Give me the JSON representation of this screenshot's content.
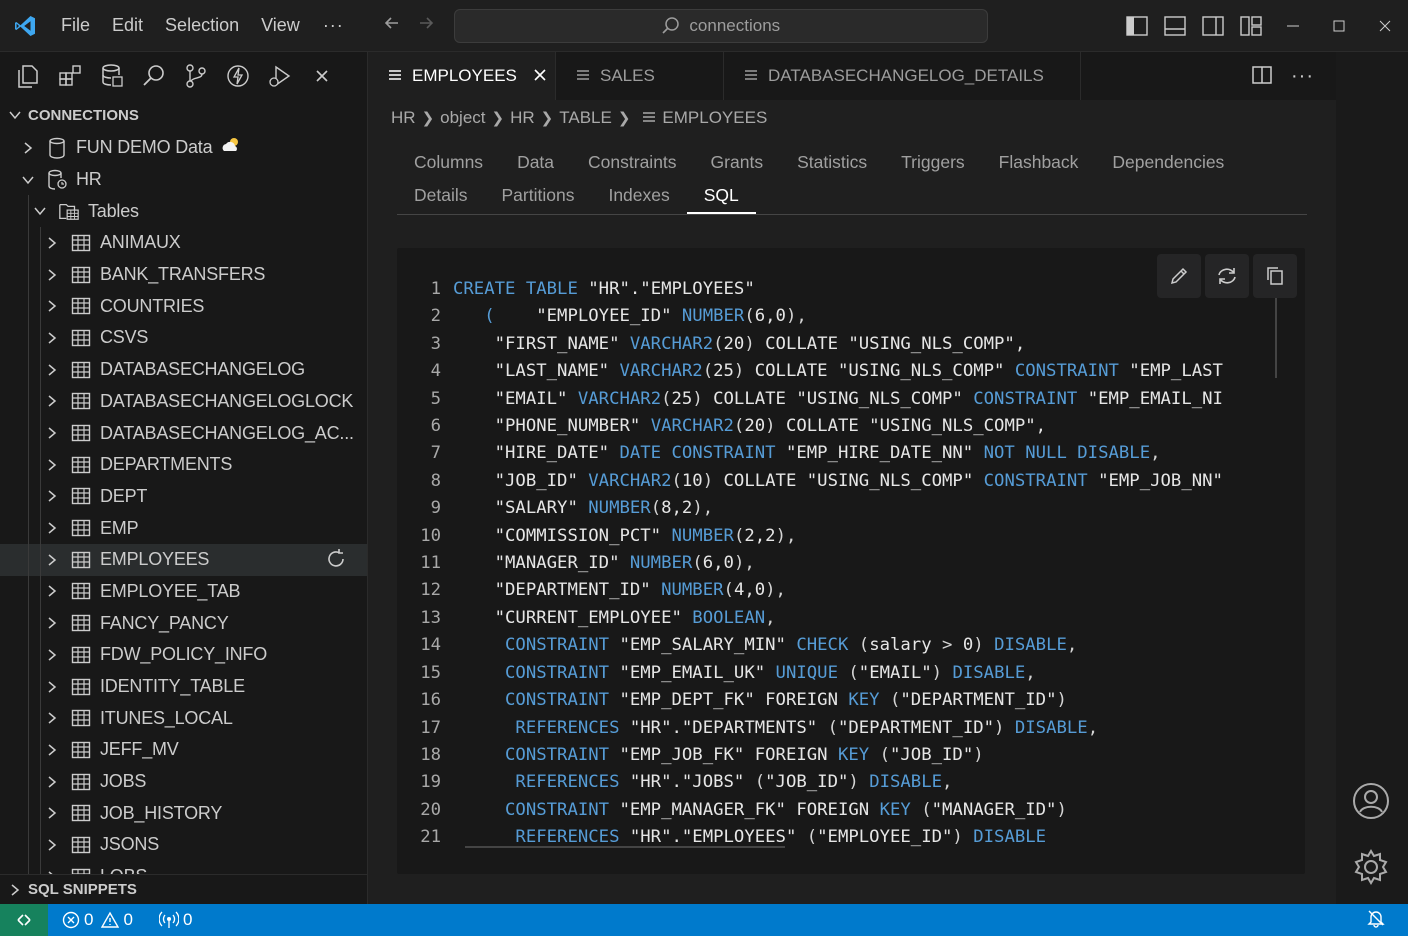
{
  "titlebar": {
    "menu": [
      "File",
      "Edit",
      "Selection",
      "View"
    ],
    "more": "···",
    "search_text": "connections"
  },
  "sidebar": {
    "connections_header": "CONNECTIONS",
    "tree": [
      {
        "label": "FUN DEMO Data",
        "level": 0,
        "icon": "database-icon"
      },
      {
        "label": "HR",
        "level": 0,
        "icon": "database-connected-icon"
      },
      {
        "label": "Tables",
        "level": 1,
        "icon": "folder-tables-icon"
      },
      {
        "label": "ANIMAUX",
        "level": 2,
        "icon": "table-icon"
      },
      {
        "label": "BANK_TRANSFERS",
        "level": 2,
        "icon": "table-icon"
      },
      {
        "label": "COUNTRIES",
        "level": 2,
        "icon": "table-icon"
      },
      {
        "label": "CSVS",
        "level": 2,
        "icon": "table-icon"
      },
      {
        "label": "DATABASECHANGELOG",
        "level": 2,
        "icon": "table-icon"
      },
      {
        "label": "DATABASECHANGELOGLOCK",
        "level": 2,
        "icon": "table-icon"
      },
      {
        "label": "DATABASECHANGELOG_AC...",
        "level": 2,
        "icon": "table-icon"
      },
      {
        "label": "DEPARTMENTS",
        "level": 2,
        "icon": "table-icon"
      },
      {
        "label": "DEPT",
        "level": 2,
        "icon": "table-icon"
      },
      {
        "label": "EMP",
        "level": 2,
        "icon": "table-icon"
      },
      {
        "label": "EMPLOYEES",
        "level": 2,
        "icon": "table-icon",
        "selected": true
      },
      {
        "label": "EMPLOYEE_TAB",
        "level": 2,
        "icon": "table-icon"
      },
      {
        "label": "FANCY_PANCY",
        "level": 2,
        "icon": "table-icon"
      },
      {
        "label": "FDW_POLICY_INFO",
        "level": 2,
        "icon": "table-icon"
      },
      {
        "label": "IDENTITY_TABLE",
        "level": 2,
        "icon": "table-icon"
      },
      {
        "label": "ITUNES_LOCAL",
        "level": 2,
        "icon": "table-icon"
      },
      {
        "label": "JEFF_MV",
        "level": 2,
        "icon": "table-icon"
      },
      {
        "label": "JOBS",
        "level": 2,
        "icon": "table-icon"
      },
      {
        "label": "JOB_HISTORY",
        "level": 2,
        "icon": "table-icon"
      },
      {
        "label": "JSONS",
        "level": 2,
        "icon": "table-icon"
      },
      {
        "label": "LOBS",
        "level": 2,
        "icon": "table-icon"
      }
    ],
    "snippets_header": "SQL SNIPPETS"
  },
  "editor": {
    "tabs": [
      {
        "label": "EMPLOYEES",
        "active": true
      },
      {
        "label": "SALES",
        "active": false
      },
      {
        "label": "DATABASECHANGELOG_DETAILS",
        "active": false
      }
    ],
    "breadcrumb": [
      "HR",
      "object",
      "HR",
      "TABLE",
      "EMPLOYEES"
    ],
    "detail_tabs_row1": [
      "Columns",
      "Data",
      "Constraints",
      "Grants",
      "Statistics",
      "Triggers",
      "Flashback",
      "Dependencies"
    ],
    "detail_tabs_row2": [
      "Details",
      "Partitions",
      "Indexes",
      "SQL"
    ],
    "active_detail_tab": "SQL",
    "code_lines": [
      [
        [
          "k",
          "CREATE TABLE "
        ],
        [
          "s",
          "\"HR\".\"EMPLOYEES\""
        ]
      ],
      [
        [
          "k",
          "   (    "
        ],
        [
          "s",
          "\"EMPLOYEE_ID\" "
        ],
        [
          "k",
          "NUMBER"
        ],
        [
          "p",
          "("
        ],
        [
          "s",
          "6,0"
        ],
        [
          "p",
          "),"
        ]
      ],
      [
        [
          "s",
          "    \"FIRST_NAME\" "
        ],
        [
          "k",
          "VARCHAR2"
        ],
        [
          "p",
          "("
        ],
        [
          "s",
          "20"
        ],
        [
          "p",
          ") "
        ],
        [
          "s",
          "COLLATE \"USING_NLS_COMP\","
        ]
      ],
      [
        [
          "s",
          "    \"LAST_NAME\" "
        ],
        [
          "k",
          "VARCHAR2"
        ],
        [
          "p",
          "("
        ],
        [
          "s",
          "25"
        ],
        [
          "p",
          ") "
        ],
        [
          "s",
          "COLLATE \"USING_NLS_COMP\" "
        ],
        [
          "k",
          "CONSTRAINT "
        ],
        [
          "s",
          "\"EMP_LAST"
        ]
      ],
      [
        [
          "s",
          "    \"EMAIL\" "
        ],
        [
          "k",
          "VARCHAR2"
        ],
        [
          "p",
          "("
        ],
        [
          "s",
          "25"
        ],
        [
          "p",
          ") "
        ],
        [
          "s",
          "COLLATE \"USING_NLS_COMP\" "
        ],
        [
          "k",
          "CONSTRAINT "
        ],
        [
          "s",
          "\"EMP_EMAIL_NI"
        ]
      ],
      [
        [
          "s",
          "    \"PHONE_NUMBER\" "
        ],
        [
          "k",
          "VARCHAR2"
        ],
        [
          "p",
          "("
        ],
        [
          "s",
          "20"
        ],
        [
          "p",
          ") "
        ],
        [
          "s",
          "COLLATE \"USING_NLS_COMP\","
        ]
      ],
      [
        [
          "s",
          "    \"HIRE_DATE\" "
        ],
        [
          "k",
          "DATE CONSTRAINT "
        ],
        [
          "s",
          "\"EMP_HIRE_DATE_NN\" "
        ],
        [
          "k",
          "NOT NULL DISABLE"
        ],
        [
          "p",
          ","
        ]
      ],
      [
        [
          "s",
          "    \"JOB_ID\" "
        ],
        [
          "k",
          "VARCHAR2"
        ],
        [
          "p",
          "("
        ],
        [
          "s",
          "10"
        ],
        [
          "p",
          ") "
        ],
        [
          "s",
          "COLLATE \"USING_NLS_COMP\" "
        ],
        [
          "k",
          "CONSTRAINT "
        ],
        [
          "s",
          "\"EMP_JOB_NN\""
        ]
      ],
      [
        [
          "s",
          "    \"SALARY\" "
        ],
        [
          "k",
          "NUMBER"
        ],
        [
          "p",
          "("
        ],
        [
          "s",
          "8,2"
        ],
        [
          "p",
          "),"
        ]
      ],
      [
        [
          "s",
          "    \"COMMISSION_PCT\" "
        ],
        [
          "k",
          "NUMBER"
        ],
        [
          "p",
          "("
        ],
        [
          "s",
          "2,2"
        ],
        [
          "p",
          "),"
        ]
      ],
      [
        [
          "s",
          "    \"MANAGER_ID\" "
        ],
        [
          "k",
          "NUMBER"
        ],
        [
          "p",
          "("
        ],
        [
          "s",
          "6,0"
        ],
        [
          "p",
          "),"
        ]
      ],
      [
        [
          "s",
          "    \"DEPARTMENT_ID\" "
        ],
        [
          "k",
          "NUMBER"
        ],
        [
          "p",
          "("
        ],
        [
          "s",
          "4,0"
        ],
        [
          "p",
          "),"
        ]
      ],
      [
        [
          "s",
          "    \"CURRENT_EMPLOYEE\" "
        ],
        [
          "k",
          "BOOLEAN"
        ],
        [
          "p",
          ","
        ]
      ],
      [
        [
          "k",
          "     CONSTRAINT "
        ],
        [
          "s",
          "\"EMP_SALARY_MIN\" "
        ],
        [
          "k",
          "CHECK "
        ],
        [
          "p",
          "("
        ],
        [
          "s",
          "salary "
        ],
        [
          "p",
          "> "
        ],
        [
          "s",
          "0"
        ],
        [
          "p",
          ") "
        ],
        [
          "k",
          "DISABLE"
        ],
        [
          "p",
          ","
        ]
      ],
      [
        [
          "k",
          "     CONSTRAINT "
        ],
        [
          "s",
          "\"EMP_EMAIL_UK\" "
        ],
        [
          "k",
          "UNIQUE "
        ],
        [
          "p",
          "("
        ],
        [
          "s",
          "\"EMAIL\""
        ],
        [
          "p",
          ") "
        ],
        [
          "k",
          "DISABLE"
        ],
        [
          "p",
          ","
        ]
      ],
      [
        [
          "k",
          "     CONSTRAINT "
        ],
        [
          "s",
          "\"EMP_DEPT_FK\" "
        ],
        [
          "s",
          "FOREIGN "
        ],
        [
          "k",
          "KEY "
        ],
        [
          "p",
          "("
        ],
        [
          "s",
          "\"DEPARTMENT_ID\""
        ],
        [
          "p",
          ")"
        ]
      ],
      [
        [
          "k",
          "      REFERENCES "
        ],
        [
          "s",
          "\"HR\".\"DEPARTMENTS\" "
        ],
        [
          "p",
          "("
        ],
        [
          "s",
          "\"DEPARTMENT_ID\""
        ],
        [
          "p",
          ") "
        ],
        [
          "k",
          "DISABLE"
        ],
        [
          "p",
          ","
        ]
      ],
      [
        [
          "k",
          "     CONSTRAINT "
        ],
        [
          "s",
          "\"EMP_JOB_FK\" "
        ],
        [
          "s",
          "FOREIGN "
        ],
        [
          "k",
          "KEY "
        ],
        [
          "p",
          "("
        ],
        [
          "s",
          "\"JOB_ID\""
        ],
        [
          "p",
          ")"
        ]
      ],
      [
        [
          "k",
          "      REFERENCES "
        ],
        [
          "s",
          "\"HR\".\"JOBS\" "
        ],
        [
          "p",
          "("
        ],
        [
          "s",
          "\"JOB_ID\""
        ],
        [
          "p",
          ") "
        ],
        [
          "k",
          "DISABLE"
        ],
        [
          "p",
          ","
        ]
      ],
      [
        [
          "k",
          "     CONSTRAINT "
        ],
        [
          "s",
          "\"EMP_MANAGER_FK\" "
        ],
        [
          "s",
          "FOREIGN "
        ],
        [
          "k",
          "KEY "
        ],
        [
          "p",
          "("
        ],
        [
          "s",
          "\"MANAGER_ID\""
        ],
        [
          "p",
          ")"
        ]
      ],
      [
        [
          "k",
          "      REFERENCES "
        ],
        [
          "s",
          "\"HR\".\"EMPLOYEES\" "
        ],
        [
          "p",
          "("
        ],
        [
          "s",
          "\"EMPLOYEE_ID\""
        ],
        [
          "p",
          ") "
        ],
        [
          "k",
          "DISABLE"
        ]
      ]
    ]
  },
  "statusbar": {
    "errors": "0",
    "warnings": "0",
    "ports": "0"
  },
  "colors": {
    "keyword": "#569cd6",
    "accent": "#007acc",
    "remote": "#16825d"
  }
}
